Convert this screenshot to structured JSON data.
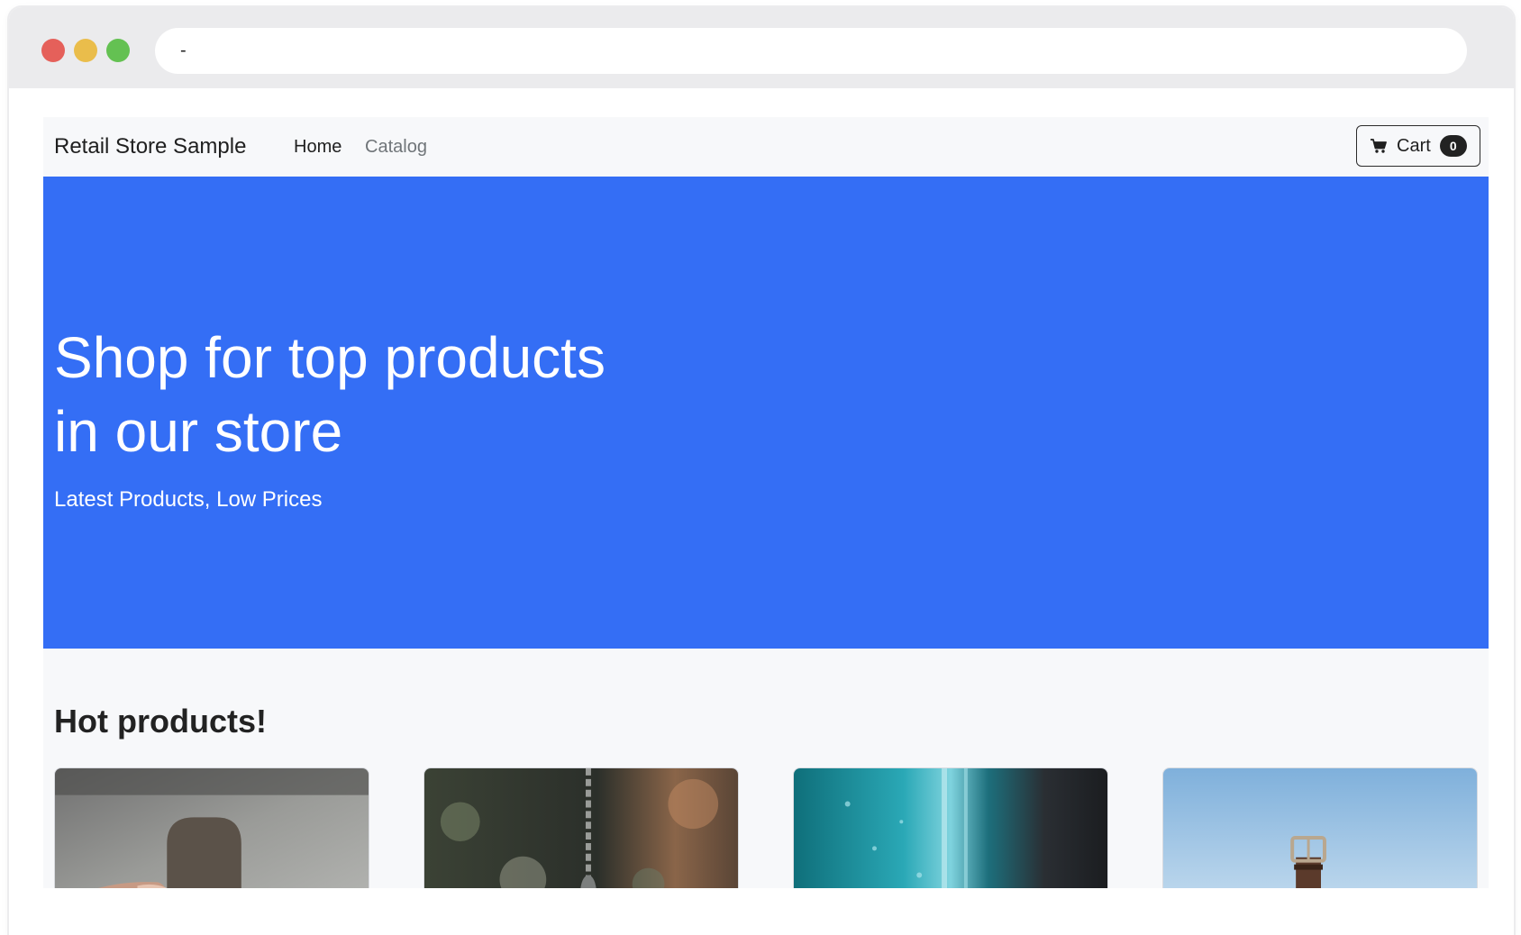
{
  "browser": {
    "url_text": "-",
    "controls": [
      "close",
      "minimize",
      "maximize"
    ]
  },
  "navbar": {
    "brand": "Retail Store Sample",
    "links": [
      {
        "label": "Home",
        "active": true
      },
      {
        "label": "Catalog",
        "active": false
      }
    ],
    "cart": {
      "icon": "cart-icon",
      "label": "Cart",
      "count": "0"
    }
  },
  "hero": {
    "title": "Shop for top products in our store",
    "subtitle": "Latest Products, Low Prices",
    "background_color": "#346ef5"
  },
  "hot_products": {
    "title": "Hot products!",
    "items": [
      {
        "image": "product-image-1"
      },
      {
        "image": "product-image-2"
      },
      {
        "image": "product-image-3"
      },
      {
        "image": "product-image-4"
      }
    ]
  }
}
